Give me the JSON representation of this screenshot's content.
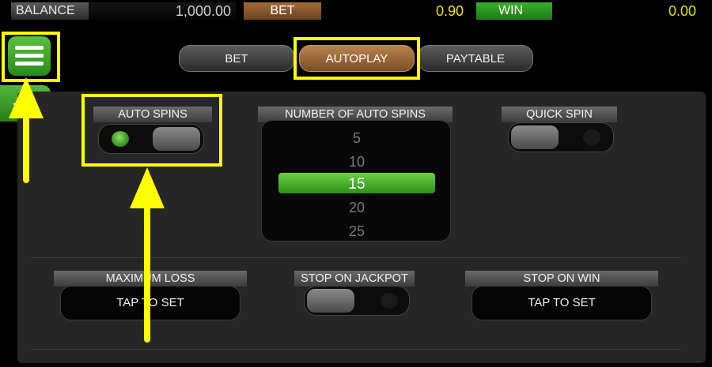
{
  "status_bar": {
    "balance_label": "BALANCE",
    "balance_value": "1,000.00",
    "bet_label": "BET",
    "bet_value": "0.90",
    "win_label": "WIN",
    "win_value": "0.00"
  },
  "tabs": [
    {
      "label": "BET",
      "active": false
    },
    {
      "label": "AUTOPLAY",
      "active": true
    },
    {
      "label": "PAYTABLE",
      "active": false
    }
  ],
  "auto_spins": {
    "label": "AUTO SPINS",
    "state": "on"
  },
  "number_of_auto_spins": {
    "label": "NUMBER OF AUTO SPINS",
    "options": [
      "5",
      "10",
      "15",
      "20",
      "25"
    ],
    "selected": "15"
  },
  "quick_spin": {
    "label": "QUICK SPIN",
    "state": "off"
  },
  "maximum_loss": {
    "label": "MAXIMUM LOSS",
    "action": "TAP TO SET"
  },
  "stop_on_jackpot": {
    "label": "STOP ON JACKPOT",
    "state": "off"
  },
  "stop_on_win": {
    "label": "STOP ON WIN",
    "action": "TAP TO SET"
  },
  "icons": {
    "menu": "hamburger-menu-icon",
    "back": "arrow-left-icon"
  },
  "colors": {
    "accent_green": "#3fae28",
    "active_tab": "#9a6a3a",
    "annotation": "#ffff00",
    "bet_value": "#f2e000"
  }
}
